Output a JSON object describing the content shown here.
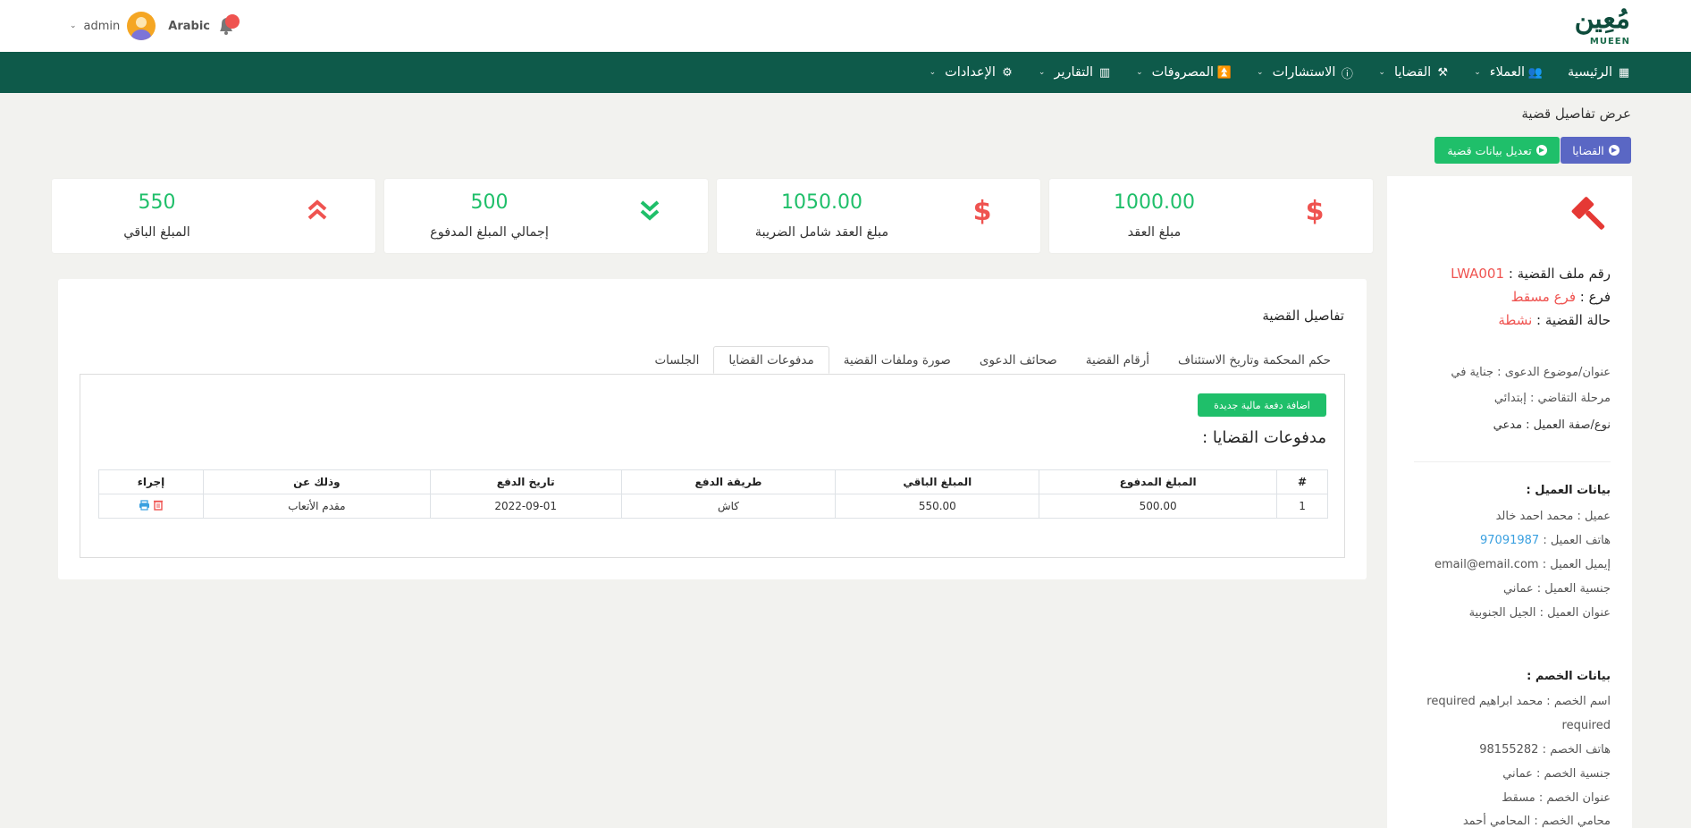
{
  "header": {
    "logo_ar": "مُعِين",
    "logo_en": "MUEEN",
    "user": "admin",
    "language": "Arabic"
  },
  "nav": [
    {
      "label": "الرئيسية",
      "icon": "dashboard-icon",
      "has_dropdown": false
    },
    {
      "label": "العملاء",
      "icon": "users-icon",
      "has_dropdown": true
    },
    {
      "label": "القضايا",
      "icon": "gavel-icon",
      "has_dropdown": true
    },
    {
      "label": "الاستشارات",
      "icon": "info-icon",
      "has_dropdown": true
    },
    {
      "label": "المصروفات",
      "icon": "angles-up-icon",
      "has_dropdown": true
    },
    {
      "label": "التقارير",
      "icon": "chart-icon",
      "has_dropdown": true
    },
    {
      "label": "الإعدادات",
      "icon": "gear-icon",
      "has_dropdown": true
    }
  ],
  "page_title": "عرض تفاصيل قضية",
  "buttons": {
    "cases": "القضايا",
    "edit_case": "تعديل بيانات قضية"
  },
  "stats": [
    {
      "label": "مبلغ العقد",
      "value": "1000.00",
      "icon": "dollar-icon",
      "icon_color": "#ef5350"
    },
    {
      "label": "مبلغ العقد شامل الضريبة",
      "value": "1050.00",
      "icon": "dollar-icon",
      "icon_color": "#ef5350"
    },
    {
      "label": "إجمالي المبلغ المدفوع",
      "value": "500",
      "icon": "angles-down-icon",
      "icon_color": "#1fbf6a"
    },
    {
      "label": "المبلغ الباقي",
      "value": "550",
      "icon": "angles-up-icon",
      "icon_color": "#ef5350"
    }
  ],
  "side": {
    "file_no_label": "رقم ملف القضية :",
    "file_no": "LWA001",
    "branch_label": "فرع :",
    "branch": "فرع مسقط",
    "status_label": "حالة القضية :",
    "status": "نشطة",
    "subject": "عنوان/موضوع الدعوى : جناية في",
    "stage": "مرحلة التقاضي : إبتدائي",
    "client_type": "نوع/صفة العميل : مدعي",
    "client_heading": "بيانات العميل :",
    "client_name": "عميل : محمد احمد خالد",
    "client_phone_label": "هاتف العميل :",
    "client_phone": "97091987",
    "client_email": "إيميل العميل : email@email.com",
    "client_nationality": "جنسية العميل : عماني",
    "client_address": "عنوان العميل : الجيل الجنوبية",
    "opponent_heading": "بيانات الخصم :",
    "opponent_name": "اسم الخصم : محمد ابراهيم required",
    "opponent_name_cont": "required",
    "opponent_phone": "هاتف الخصم : 98155282",
    "opponent_nationality": "جنسية الخصم : عماني",
    "opponent_address": "عنوان الخصم : مسقط",
    "opponent_lawyer": "محامي الخصم : المحامي أحمد"
  },
  "main": {
    "title": "تفاصيل القضية",
    "tabs": [
      "الجلسات",
      "مدفوعات القضايا",
      "صورة وملفات القضية",
      "صحائف الدعوى",
      "أرقام القضية",
      "حكم المحكمة وتاريخ الاستئناف"
    ],
    "active_tab": 1,
    "add_payment": "اضافة دفعة مالية جديدة",
    "pane_title": "مدفوعات القضايا :",
    "table_headers": [
      "#",
      "المبلغ المدفوع",
      "المبلغ الباقي",
      "طريقة الدفع",
      "تاريخ الدفع",
      "وذلك عن",
      "إجراء"
    ],
    "rows": [
      [
        "1",
        "500.00",
        "550.00",
        "كاش",
        "2022-09-01",
        "مقدم الأتعاب"
      ]
    ]
  }
}
